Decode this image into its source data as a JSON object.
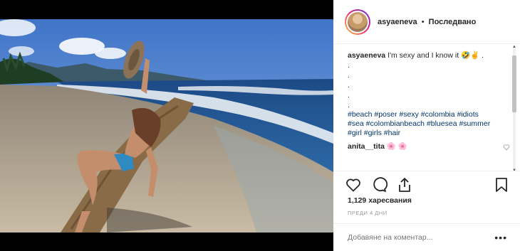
{
  "post": {
    "username": "asyaeneva",
    "separator": "•",
    "follow_status": "Последвано",
    "caption_text": "I'm sexy and I know it",
    "caption_emoji": "🤣✌",
    "caption_tail": ".",
    "dot_lines": [
      ".",
      ".",
      ".",
      ".",
      "."
    ],
    "hashtags_line1": "#beach #poser #sexy #colombia #idiots",
    "hashtags_line2": "#sea #colombianbeach #bluesea #summer",
    "hashtags_line3": "#girl #girls #hair",
    "comment": {
      "username": "anita__tita",
      "text": "🌸 🌸"
    },
    "likes": "1,129 харесвания",
    "time_ago": "ПРЕДИ 4 ДНИ",
    "add_comment_placeholder": "Добавяне на коментар...",
    "more_options": "•••"
  },
  "icons": {
    "like": "heart-icon",
    "comment": "comment-icon",
    "share": "share-icon",
    "save": "bookmark-icon"
  },
  "colors": {
    "hashtag": "#003569",
    "text": "#262626",
    "muted": "#999999",
    "sky": "#4a7bc4",
    "sea": "#1f4f8a",
    "sand": "#b8a994"
  }
}
